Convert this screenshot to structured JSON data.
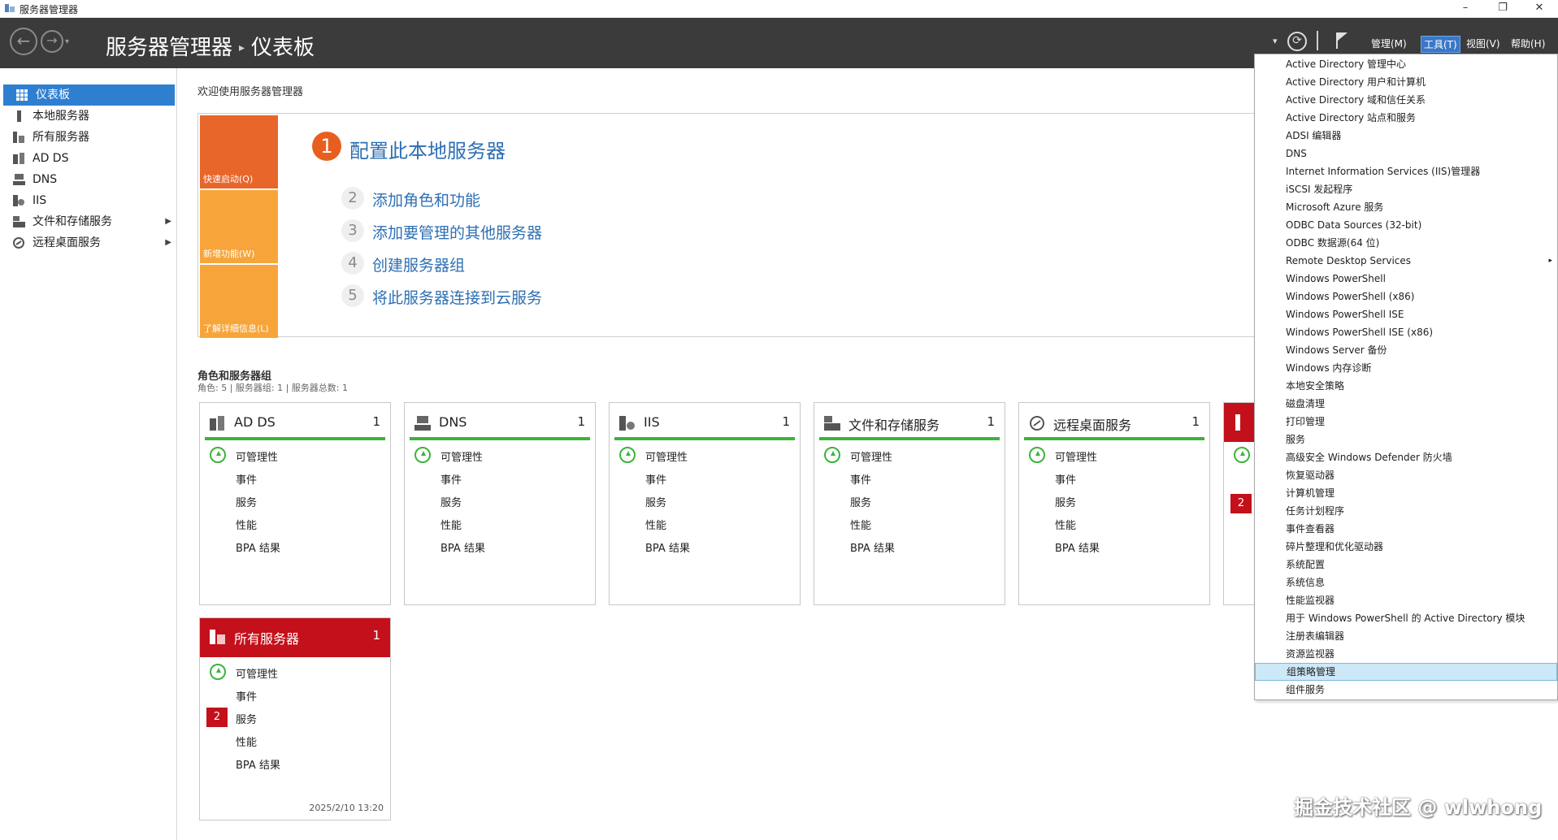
{
  "window": {
    "title": "服务器管理器",
    "minimize": "–",
    "restore": "❐",
    "close": "✕"
  },
  "header": {
    "app_name": "服务器管理器",
    "page_name": "仪表板",
    "separator": "▸",
    "menus": {
      "manage": "管理(M)",
      "tools": "工具(T)",
      "view": "视图(V)",
      "help": "帮助(H)"
    }
  },
  "sidebar": {
    "items": [
      {
        "label": "仪表板"
      },
      {
        "label": "本地服务器"
      },
      {
        "label": "所有服务器"
      },
      {
        "label": "AD DS"
      },
      {
        "label": "DNS"
      },
      {
        "label": "IIS"
      },
      {
        "label": "文件和存储服务"
      },
      {
        "label": "远程桌面服务"
      }
    ]
  },
  "welcome": {
    "title": "欢迎使用服务器管理器",
    "tabs": {
      "quick_start": "快速启动(Q)",
      "whats_new": "新增功能(W)",
      "learn_more": "了解详细信息(L)"
    },
    "steps": [
      {
        "num": "1",
        "label": "配置此本地服务器"
      },
      {
        "num": "2",
        "label": "添加角色和功能"
      },
      {
        "num": "3",
        "label": "添加要管理的其他服务器"
      },
      {
        "num": "4",
        "label": "创建服务器组"
      },
      {
        "num": "5",
        "label": "将此服务器连接到云服务"
      }
    ]
  },
  "roles": {
    "title": "角色和服务器组",
    "subtitle": "角色: 5 | 服务器组: 1 | 服务器总数: 1",
    "row_labels": {
      "manageability": "可管理性",
      "events": "事件",
      "services": "服务",
      "performance": "性能",
      "bpa": "BPA 结果"
    },
    "tiles": [
      {
        "name": "AD DS",
        "count": "1"
      },
      {
        "name": "DNS",
        "count": "1"
      },
      {
        "name": "IIS",
        "count": "1"
      },
      {
        "name": "文件和存储服务",
        "count": "1"
      },
      {
        "name": "远程桌面服务",
        "count": "1"
      }
    ],
    "partial_tile_badge": "2",
    "all_servers": {
      "name": "所有服务器",
      "count": "1",
      "services_badge": "2",
      "timestamp": "2025/2/10 13:20"
    }
  },
  "tools_menu": {
    "items": [
      "Active Directory 管理中心",
      "Active Directory 用户和计算机",
      "Active Directory 域和信任关系",
      "Active Directory 站点和服务",
      "ADSI 编辑器",
      "DNS",
      "Internet Information Services (IIS)管理器",
      "iSCSI 发起程序",
      "Microsoft Azure 服务",
      "ODBC Data Sources (32-bit)",
      "ODBC 数据源(64 位)",
      "Remote Desktop Services",
      "Windows PowerShell",
      "Windows PowerShell (x86)",
      "Windows PowerShell ISE",
      "Windows PowerShell ISE (x86)",
      "Windows Server 备份",
      "Windows 内存诊断",
      "本地安全策略",
      "磁盘清理",
      "打印管理",
      "服务",
      "高级安全 Windows Defender 防火墙",
      "恢复驱动器",
      "计算机管理",
      "任务计划程序",
      "事件查看器",
      "碎片整理和优化驱动器",
      "系统配置",
      "系统信息",
      "性能监视器",
      "用于 Windows PowerShell 的 Active Directory 模块",
      "注册表编辑器",
      "资源监视器",
      "组策略管理",
      "组件服务"
    ],
    "highlighted": "组策略管理",
    "submenu_arrow": "▸"
  },
  "watermark": "掘金技术社区 @ wlwhong",
  "colors": {
    "header_bg": "#3b3b3b",
    "accent_blue": "#2f7fd1",
    "link_blue": "#2e6fb3",
    "orange": "#e85e1e",
    "ok_green": "#3cb33c",
    "alert_red": "#c4101a"
  }
}
